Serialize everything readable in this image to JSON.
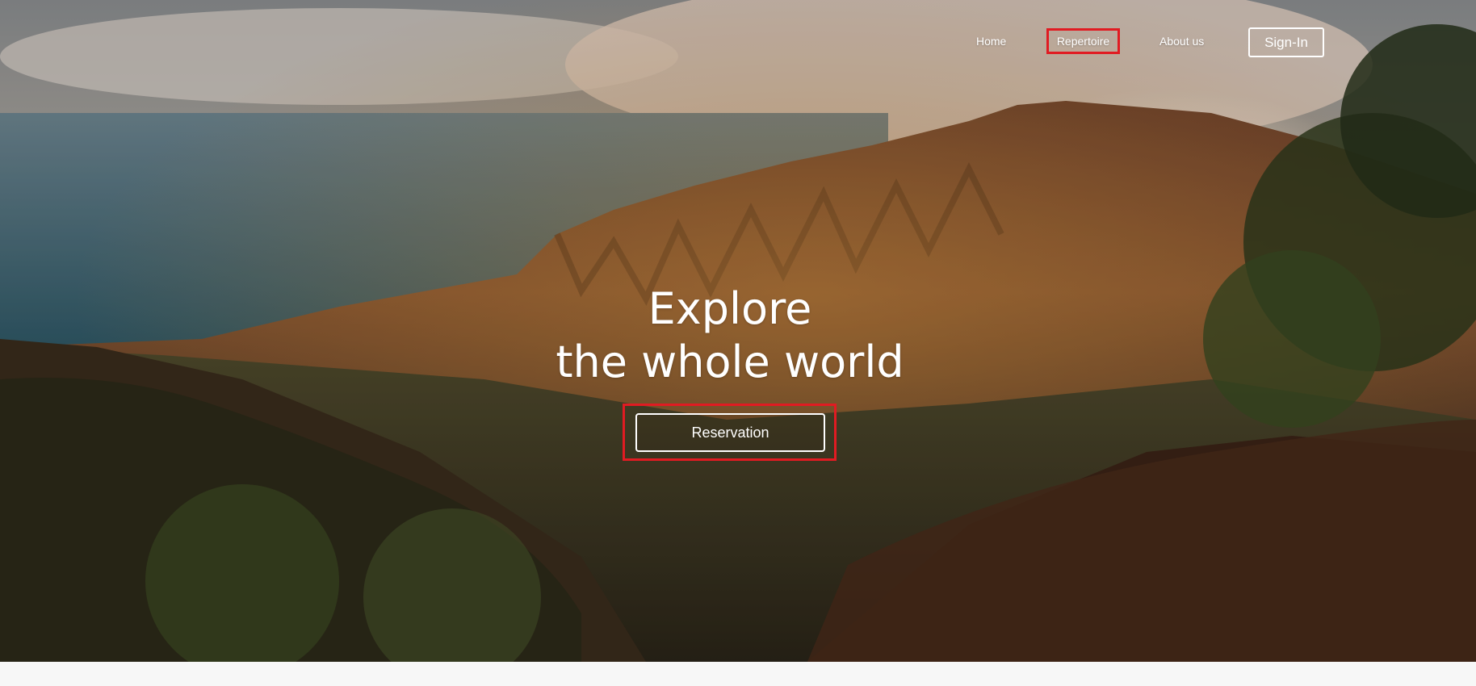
{
  "nav": {
    "home": "Home",
    "repertoire": "Repertoire",
    "about": "About us",
    "sign_in": "Sign-In"
  },
  "hero": {
    "line1": "Explore",
    "line2": "the whole world",
    "cta": "Reservation",
    "background": "mountain-valley-coast-photo"
  },
  "colors": {
    "highlight_border": "#e11b22",
    "text": "#ffffff",
    "footer_bg": "#f7f7f7"
  }
}
